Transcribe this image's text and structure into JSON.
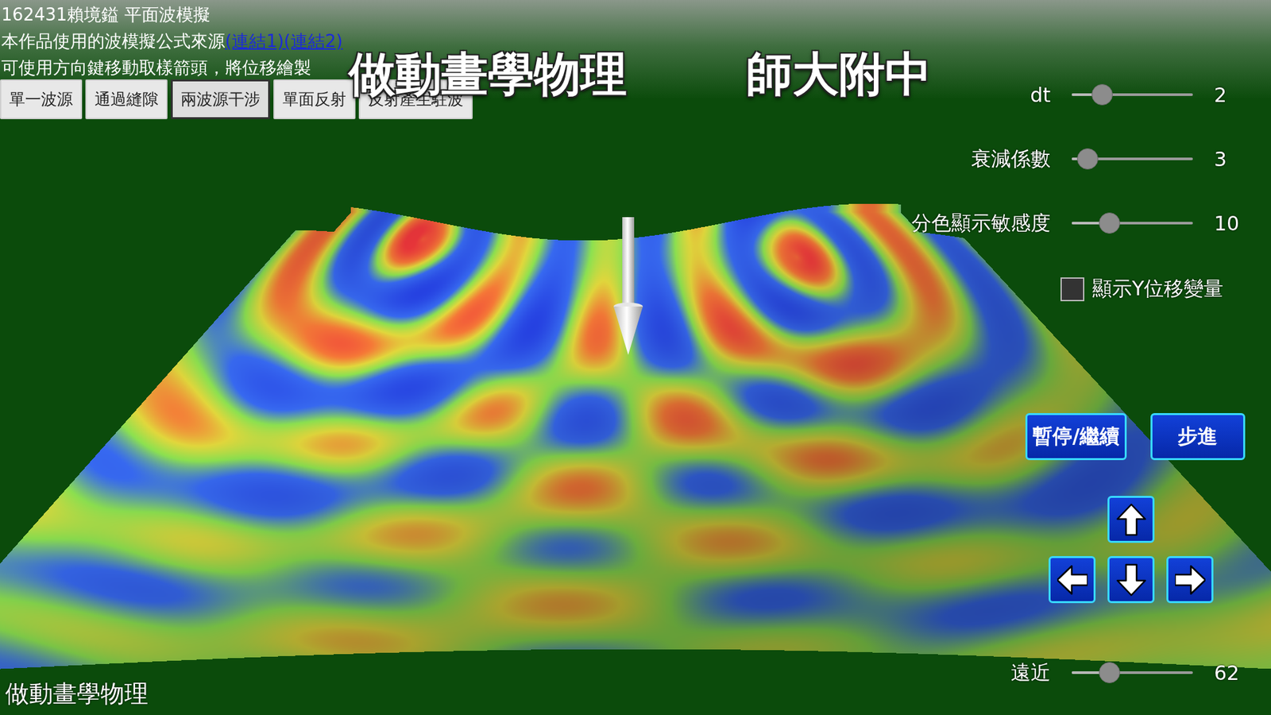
{
  "info": {
    "title": "162431賴境鎰 平面波模擬",
    "source_label": "本作品使用的波模擬公式來源",
    "links": [
      "(連結1)",
      "(連結2)"
    ],
    "hint": "可使用方向鍵移動取樣箭頭，將位移繪製"
  },
  "modes": [
    {
      "label": "單一波源",
      "selected": false
    },
    {
      "label": "通過縫隙",
      "selected": false
    },
    {
      "label": "兩波源干涉",
      "selected": true
    },
    {
      "label": "單面反射",
      "selected": false
    },
    {
      "label": "反射產生駐波",
      "selected": false
    }
  ],
  "banner": {
    "left": "做動畫學物理",
    "right": "師大附中"
  },
  "sliders": [
    {
      "label": "dt",
      "value": "2",
      "level": 0.25
    },
    {
      "label": "衰減係數",
      "value": "3",
      "level": 0.13
    },
    {
      "label": "分色顯示敏感度",
      "value": "10",
      "level": 0.31
    }
  ],
  "checkbox": {
    "label": "顯示Y位移變量",
    "checked": false
  },
  "controls": {
    "pause": "暫停/繼續",
    "step": "步進"
  },
  "distance_slider": {
    "label": "遠近",
    "value": "62",
    "level": 0.31
  },
  "footer": "做動畫學物理"
}
